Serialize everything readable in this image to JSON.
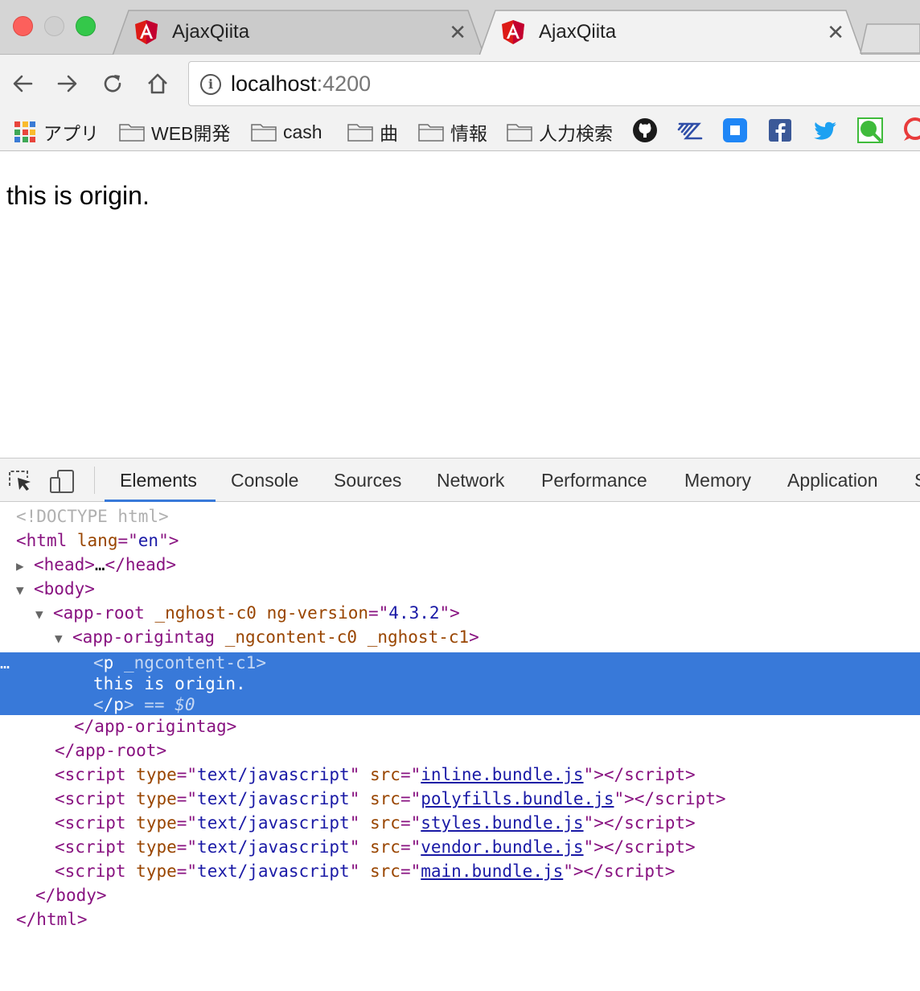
{
  "tabs": [
    {
      "title": "AjaxQiita",
      "active": false
    },
    {
      "title": "AjaxQiita",
      "active": true
    }
  ],
  "omnibox": {
    "host": "localhost",
    "port": ":4200"
  },
  "bookmarks": {
    "apps_label": "アプリ",
    "folders": [
      "WEB開発",
      "cash",
      "曲",
      "情報",
      "人力検索"
    ],
    "site_icons": [
      "github-icon",
      "zenhub-icon",
      "square-app-icon",
      "facebook-icon",
      "twitter-icon",
      "qiita-search-icon",
      "speech-bubble-icon"
    ]
  },
  "page": {
    "text": "this is origin."
  },
  "devtools": {
    "tabs": [
      "Elements",
      "Console",
      "Sources",
      "Network",
      "Performance",
      "Memory",
      "Application",
      "S"
    ],
    "active_tab": "Elements",
    "dom": {
      "doctype": "<!DOCTYPE html>",
      "html_open": {
        "tag": "html",
        "attr": "lang",
        "value": "en"
      },
      "head": {
        "open": "head",
        "ellipsis": "…",
        "close": "/head"
      },
      "body_open": "body",
      "app_root": {
        "tag": "app-root",
        "attr1": "_nghost-c0",
        "attr2": "ng-version",
        "value2": "4.3.2"
      },
      "app_origintag": {
        "tag": "app-origintag",
        "attr1": "_ngcontent-c0",
        "attr2": "_nghost-c1"
      },
      "selected": {
        "open_tag": "p",
        "attr": "_ngcontent-c1",
        "text": "this is origin.",
        "close_tag": "/p",
        "marker": "== $0",
        "dots": "…"
      },
      "app_origintag_close": "/app-origintag",
      "app_root_close": "/app-root",
      "scripts": [
        {
          "type": "text/javascript",
          "src": "inline.bundle.js"
        },
        {
          "type": "text/javascript",
          "src": "polyfills.bundle.js"
        },
        {
          "type": "text/javascript",
          "src": "styles.bundle.js"
        },
        {
          "type": "text/javascript",
          "src": "vendor.bundle.js"
        },
        {
          "type": "text/javascript",
          "src": "main.bundle.js"
        }
      ],
      "script_tag": "script",
      "script_close": "/script",
      "body_close": "/body",
      "html_close": "/html"
    }
  },
  "colors": {
    "accent": "#3879d9",
    "tag": "#881280",
    "attr": "#994500",
    "value": "#1a1aa6",
    "angular_red": "#dd1b16"
  }
}
